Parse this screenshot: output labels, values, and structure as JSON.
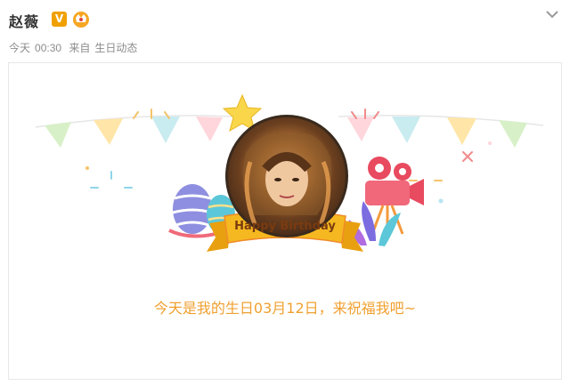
{
  "post": {
    "author_name": "赵薇",
    "verified_badge": "V",
    "member_badge_icon": "member-crown-icon",
    "timestamp_day": "今天",
    "timestamp_time": "00:30",
    "source_prefix": "来自",
    "source_name": "生日动态"
  },
  "card": {
    "banner_text": "Happy Birthday",
    "message": "今天是我的生日03月12日，来祝福我吧~",
    "icons": [
      "star-icon",
      "easter-egg-icon",
      "movie-camera-icon",
      "bunting-flags-icon"
    ]
  },
  "colors": {
    "name": "#333333",
    "meta": "#8c8c8c",
    "message": "#f0a030",
    "verified": "#f0a000",
    "banner": "#f5b820"
  }
}
